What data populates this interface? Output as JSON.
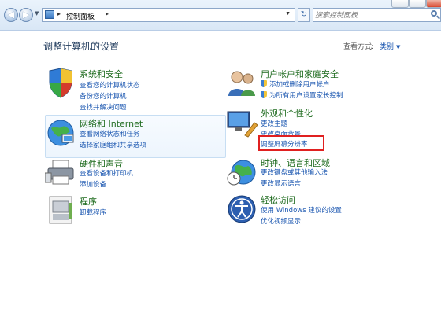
{
  "address_bar": {
    "breadcrumb": "控制面板",
    "search_placeholder": "搜索控制面板"
  },
  "header": {
    "title": "调整计算机的设置",
    "view_by_label": "查看方式:",
    "view_by_value": "类别"
  },
  "left_categories": [
    {
      "title": "系统和安全",
      "links": [
        "查看您的计算机状态",
        "备份您的计算机",
        "查找并解决问题"
      ]
    },
    {
      "title": "网络和 Internet",
      "links": [
        "查看网络状态和任务",
        "选择家庭组和共享选项"
      ]
    },
    {
      "title": "硬件和声音",
      "links": [
        "查看设备和打印机",
        "添加设备"
      ]
    },
    {
      "title": "程序",
      "links": [
        "卸载程序"
      ]
    }
  ],
  "right_categories": [
    {
      "title": "用户帐户和家庭安全",
      "links": [
        "添加或删除用户帐户",
        "为所有用户设置家长控制"
      ]
    },
    {
      "title": "外观和个性化",
      "links": [
        "更改主题",
        "更改桌面背景",
        "调整屏幕分辨率"
      ]
    },
    {
      "title": "时钟、语言和区域",
      "links": [
        "更改键盘或其他输入法",
        "更改显示语言"
      ]
    },
    {
      "title": "轻松访问",
      "links": [
        "使用 Windows 建议的设置",
        "优化视频显示"
      ]
    }
  ],
  "colors": {
    "category_title": "#1e6b1e",
    "link": "#1a56b0",
    "highlight_outline": "#e02020"
  }
}
